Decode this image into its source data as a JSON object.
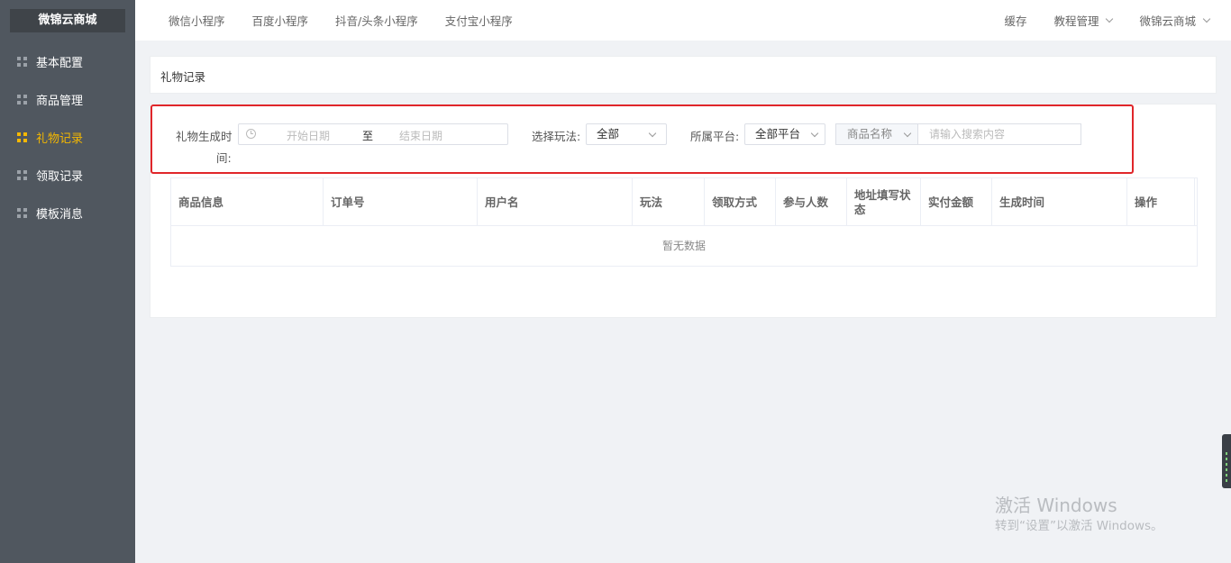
{
  "app": {
    "logo": "微锦云商城"
  },
  "sidebar": {
    "items": [
      {
        "label": "基本配置",
        "active": false
      },
      {
        "label": "商品管理",
        "active": false
      },
      {
        "label": "礼物记录",
        "active": true
      },
      {
        "label": "领取记录",
        "active": false
      },
      {
        "label": "模板消息",
        "active": false
      }
    ]
  },
  "topnav": {
    "items": [
      "微信小程序",
      "百度小程序",
      "抖音/头条小程序",
      "支付宝小程序"
    ],
    "right": {
      "cache": "缓存",
      "tutorial": "教程管理",
      "account": "微锦云商城"
    }
  },
  "breadcrumb": {
    "title": "礼物记录"
  },
  "filters": {
    "date_label_line1": "礼物生成时",
    "date_label_line2": "间:",
    "date_start_placeholder": "开始日期",
    "date_separator": "至",
    "date_end_placeholder": "结束日期",
    "play_label": "选择玩法:",
    "play_value": "全部",
    "platform_label": "所属平台:",
    "platform_value": "全部平台",
    "search_field": "商品名称",
    "search_placeholder": "请输入搜索内容"
  },
  "table": {
    "columns": [
      "商品信息",
      "订单号",
      "用户名",
      "玩法",
      "领取方式",
      "参与人数",
      "地址填写状态",
      "实付金额",
      "生成时间",
      "操作"
    ],
    "empty_text": "暂无数据"
  },
  "watermark": {
    "title": "激活 Windows",
    "subtitle": "转到“设置”以激活 Windows。"
  },
  "colors": {
    "sidebar_bg": "#50575f",
    "active": "#f5b800",
    "highlight_border": "#e0262a"
  }
}
